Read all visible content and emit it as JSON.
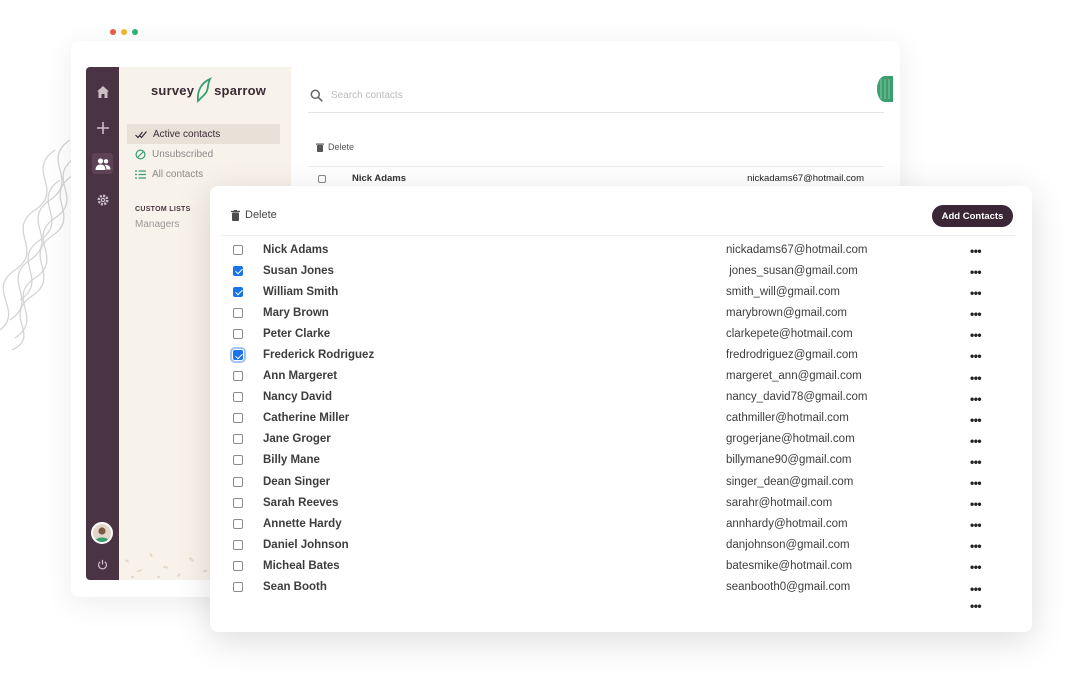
{
  "window_dots": [
    "#ee5a48",
    "#f4b82c",
    "#2fb574"
  ],
  "brand": {
    "logo_left": "survey",
    "logo_right": "sparrow",
    "accent": "#3a9e6f",
    "dark": "#4a3342"
  },
  "rail": {
    "icons": [
      "home-icon",
      "plus-icon",
      "people-icon",
      "gear-icon",
      "power-icon"
    ]
  },
  "sidebar": {
    "items": [
      {
        "label": "Active contacts",
        "icon": "double-check-icon"
      },
      {
        "label": "Unsubscribed",
        "icon": "block-icon"
      },
      {
        "label": "All contacts",
        "icon": "list-icon"
      }
    ],
    "custom_lists_heading": "CUSTOM LISTS",
    "custom_lists": [
      "Managers"
    ]
  },
  "search": {
    "placeholder": "Search contacts"
  },
  "back_table": {
    "delete_label": "Delete",
    "row": {
      "name": "Nick Adams",
      "email": "nickadams67@hotmail.com"
    }
  },
  "front": {
    "delete_label": "Delete",
    "add_button": "Add Contacts",
    "contacts": [
      {
        "name": "Nick Adams",
        "email": "nickadams67@hotmail.com",
        "checked": false
      },
      {
        "name": "Susan Jones",
        "email": " jones_susan@gmail.com",
        "checked": true
      },
      {
        "name": "William Smith",
        "email": "smith_will@gmail.com",
        "checked": true
      },
      {
        "name": "Mary Brown",
        "email": "marybrown@gmail.com",
        "checked": false
      },
      {
        "name": "Peter Clarke",
        "email": "clarkepete@hotmail.com",
        "checked": false
      },
      {
        "name": "Frederick Rodriguez",
        "email": "fredrodriguez@gmail.com",
        "checked": true,
        "focused": true
      },
      {
        "name": "Ann Margeret",
        "email": "margeret_ann@gmail.com",
        "checked": false
      },
      {
        "name": "Nancy David",
        "email": "nancy_david78@gmail.com",
        "checked": false
      },
      {
        "name": "Catherine Miller",
        "email": "cathmiller@hotmail.com",
        "checked": false
      },
      {
        "name": "Jane Groger",
        "email": "grogerjane@hotmail.com",
        "checked": false
      },
      {
        "name": "Billy Mane",
        "email": "billymane90@gmail.com",
        "checked": false
      },
      {
        "name": "Dean Singer",
        "email": "singer_dean@gmail.com",
        "checked": false
      },
      {
        "name": "Sarah Reeves",
        "email": "sarahr@hotmail.com",
        "checked": false
      },
      {
        "name": "Annette Hardy",
        "email": "annhardy@hotmail.com",
        "checked": false
      },
      {
        "name": "Daniel Johnson",
        "email": "danjohnson@gmail.com",
        "checked": false
      },
      {
        "name": "Micheal Bates",
        "email": "batesmike@hotmail.com",
        "checked": false
      },
      {
        "name": "Sean Booth",
        "email": "seanbooth0@gmail.com",
        "checked": false
      }
    ],
    "more_icon_text": "•••"
  }
}
